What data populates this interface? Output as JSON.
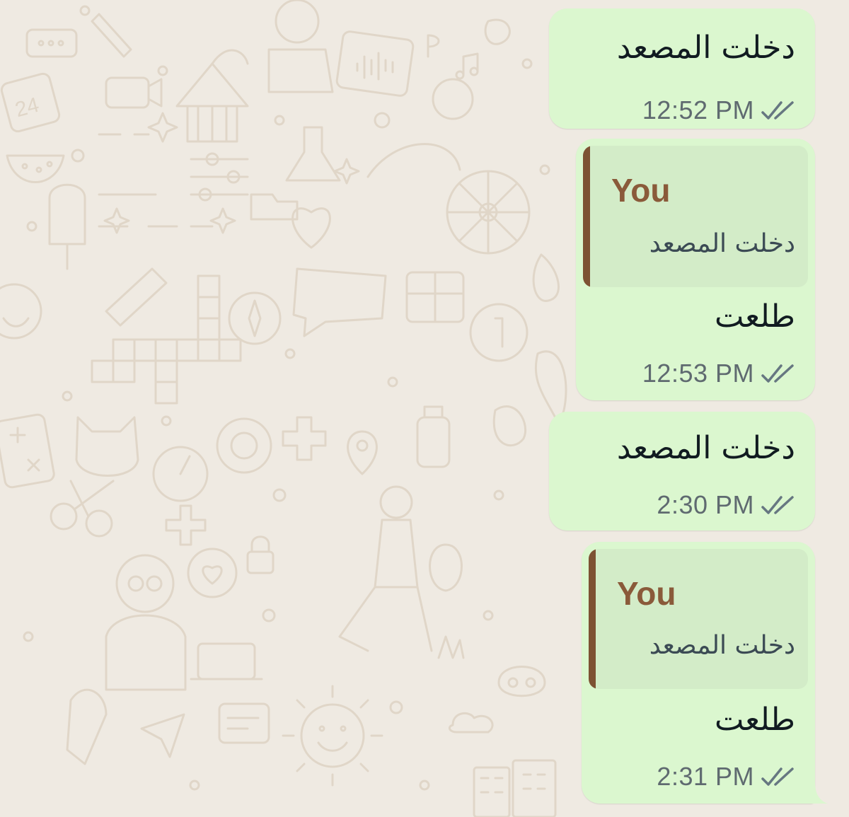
{
  "wallpaper": {
    "background_color": "#efeae2",
    "doodle_color": "#e0d6c8"
  },
  "theme": {
    "outgoing_bubble_color": "#dbf7cf",
    "quote_background_color": "#d3ecc8",
    "quote_bar_color": "#7d5233",
    "quote_author_color": "#8a5a3a",
    "time_color": "#5f6a70",
    "tick_icon": "double-check-icon"
  },
  "messages": [
    {
      "text": "دخلت المصعد",
      "time": "12:52 PM",
      "status": "delivered"
    },
    {
      "reply_to": {
        "author": "You",
        "text": "دخلت المصعد"
      },
      "text": "طلعت",
      "time": "12:53 PM",
      "status": "delivered"
    },
    {
      "text": "دخلت المصعد",
      "time": "2:30 PM",
      "status": "delivered"
    },
    {
      "reply_to": {
        "author": "You",
        "text": "دخلت المصعد"
      },
      "text": "طلعت",
      "time": "2:31 PM",
      "status": "delivered"
    }
  ]
}
